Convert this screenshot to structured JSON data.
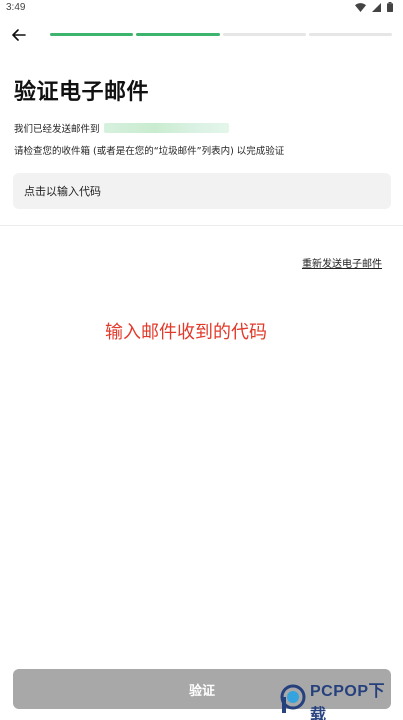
{
  "status_bar": {
    "time": "3:49",
    "icons": [
      "wifi-icon",
      "signal-icon",
      "battery-icon"
    ]
  },
  "nav": {
    "back_icon": "arrow-left-icon",
    "progress": {
      "total_steps": 4,
      "completed_steps": 2,
      "color_done": "#3cb46e",
      "color_todo": "#e6e6e6"
    }
  },
  "page": {
    "title": "验证电子邮件",
    "sent_prefix": "我们已经发送邮件到",
    "instruction": "请检查您的收件箱 (或者是在您的“垃圾邮件”列表内) 以完成验证"
  },
  "code_input": {
    "placeholder": "点击以输入代码",
    "value": ""
  },
  "resend": {
    "label": "重新发送电子邮件"
  },
  "annotation": {
    "text": "输入邮件收到的代码",
    "color": "#e23a2a"
  },
  "verify": {
    "label": "验证",
    "color": "#a8a8a8"
  },
  "watermark": {
    "text": "PCPOP下载"
  }
}
